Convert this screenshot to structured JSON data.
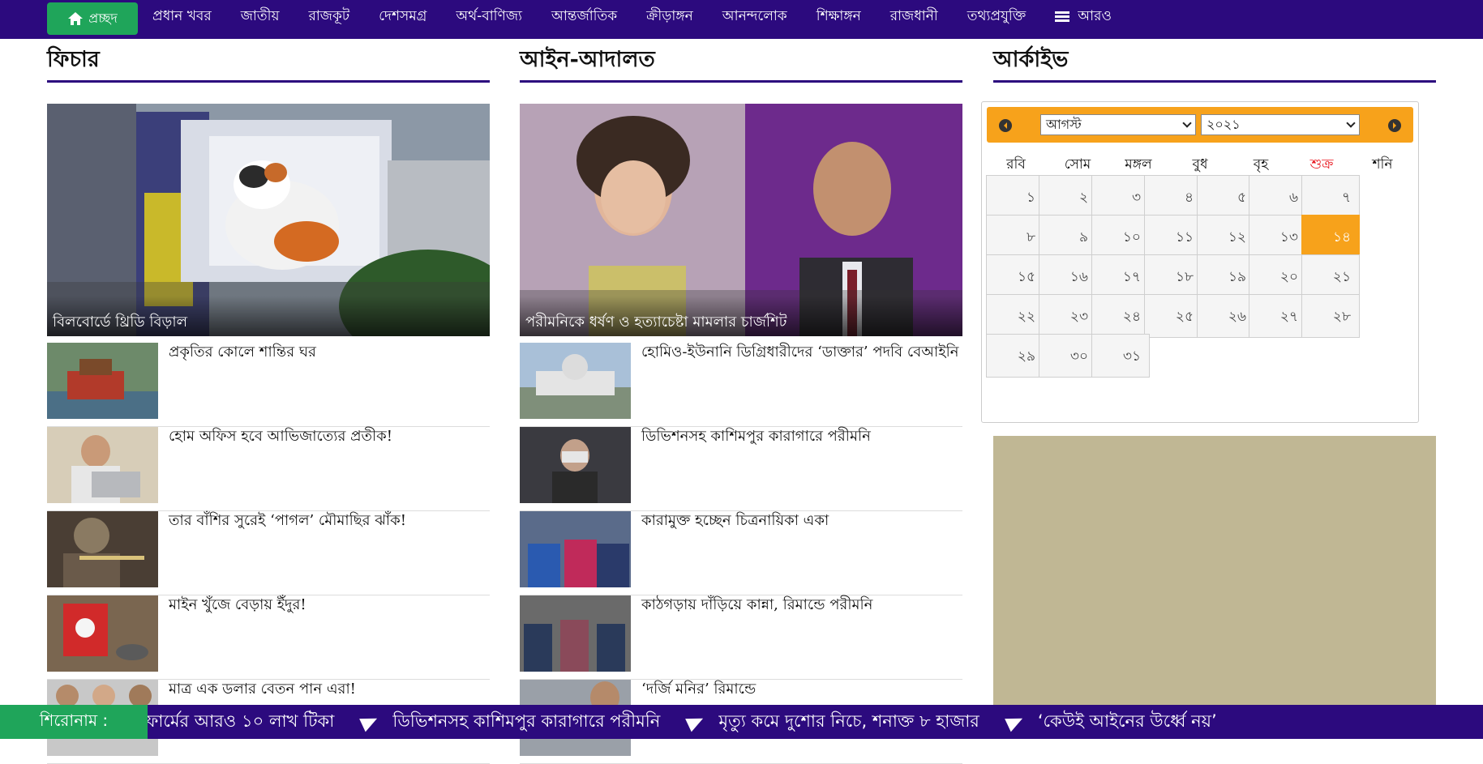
{
  "nav": {
    "home_label": "প্রচ্ছদ",
    "items": [
      "প্রধান খবর",
      "জাতীয়",
      "রাজকূট",
      "দেশসমগ্র",
      "অর্থ-বাণিজ্য",
      "আন্তর্জাতিক",
      "ক্রীড়াঙ্গন",
      "আনন্দলোক",
      "শিক্ষাঙ্গন",
      "রাজধানী",
      "তথ্যপ্রযুক্তি"
    ],
    "more_label": "আরও"
  },
  "feature": {
    "heading": "ফিচার",
    "lead_caption": "বিলবোর্ডে থ্রিডি বিড়াল",
    "items": [
      {
        "title": "প্রকৃতির কোলে শান্তির ঘর"
      },
      {
        "title": "হোম অফিস হবে আভিজাত্যের প্রতীক!"
      },
      {
        "title": "তার বাঁশির সুরেই ‘পাগল’ মৌমাছির ঝাঁক!"
      },
      {
        "title": "মাইন খুঁজে বেড়ায় ইঁদুর!"
      },
      {
        "title": "মাত্র এক ডলার বেতন পান এরা!"
      }
    ]
  },
  "court": {
    "heading": "আইন-আদালত",
    "lead_caption": "পরীমনিকে ধর্ষণ ও হত্যাচেষ্টা মামলার চার্জশিট",
    "items": [
      {
        "title": "হোমিও-ইউনানি ডিগ্রিধারীদের ‘ডাক্তার’ পদবি বেআইনি"
      },
      {
        "title": "ডিভিশনসহ কাশিমপুর কারাগারে পরীমনি"
      },
      {
        "title": "কারামুক্ত হচ্ছেন চিত্রনায়িকা একা"
      },
      {
        "title": "কাঠগড়ায় দাঁড়িয়ে কান্না, রিমান্ডে পরীমনি"
      },
      {
        "title": "‘দর্জি মনির’ রিমান্ডে"
      }
    ]
  },
  "archive": {
    "heading": "আর্কাইভ",
    "month": "আগস্ট",
    "year": "২০২১",
    "weekdays": [
      "রবি",
      "সোম",
      "মঙ্গল",
      "বুধ",
      "বৃহ",
      "শুক্র",
      "শনি"
    ],
    "friday_color": "#e8141c",
    "days": [
      "১",
      "২",
      "৩",
      "৪",
      "৫",
      "৬",
      "৭",
      "৮",
      "৯",
      "১০",
      "১১",
      "১২",
      "১৩",
      "১৪",
      "১৫",
      "১৬",
      "১৭",
      "১৮",
      "১৯",
      "২০",
      "২১",
      "২২",
      "২৩",
      "২৪",
      "২৫",
      "২৬",
      "২৭",
      "২৮",
      "২৯",
      "৩০",
      "৩১"
    ],
    "selected_day": "১৪"
  },
  "ticker": {
    "label": "শিরোনাম :",
    "items": [
      "ফার্মের আরও ১০ লাখ টিকা",
      "ডিভিশনসহ কাশিমপুর কারাগারে পরীমনি",
      "মৃত্যু কমে দুশোর নিচে, শনাক্ত ৮ হাজার",
      "‘কেউই আইনের উর্ধ্বে নয়’"
    ]
  },
  "colors": {
    "brand": "#2c0a7e",
    "accent_green": "#1fa55a",
    "accent_orange": "#f7a21b",
    "ad_bg": "#c0b794"
  }
}
